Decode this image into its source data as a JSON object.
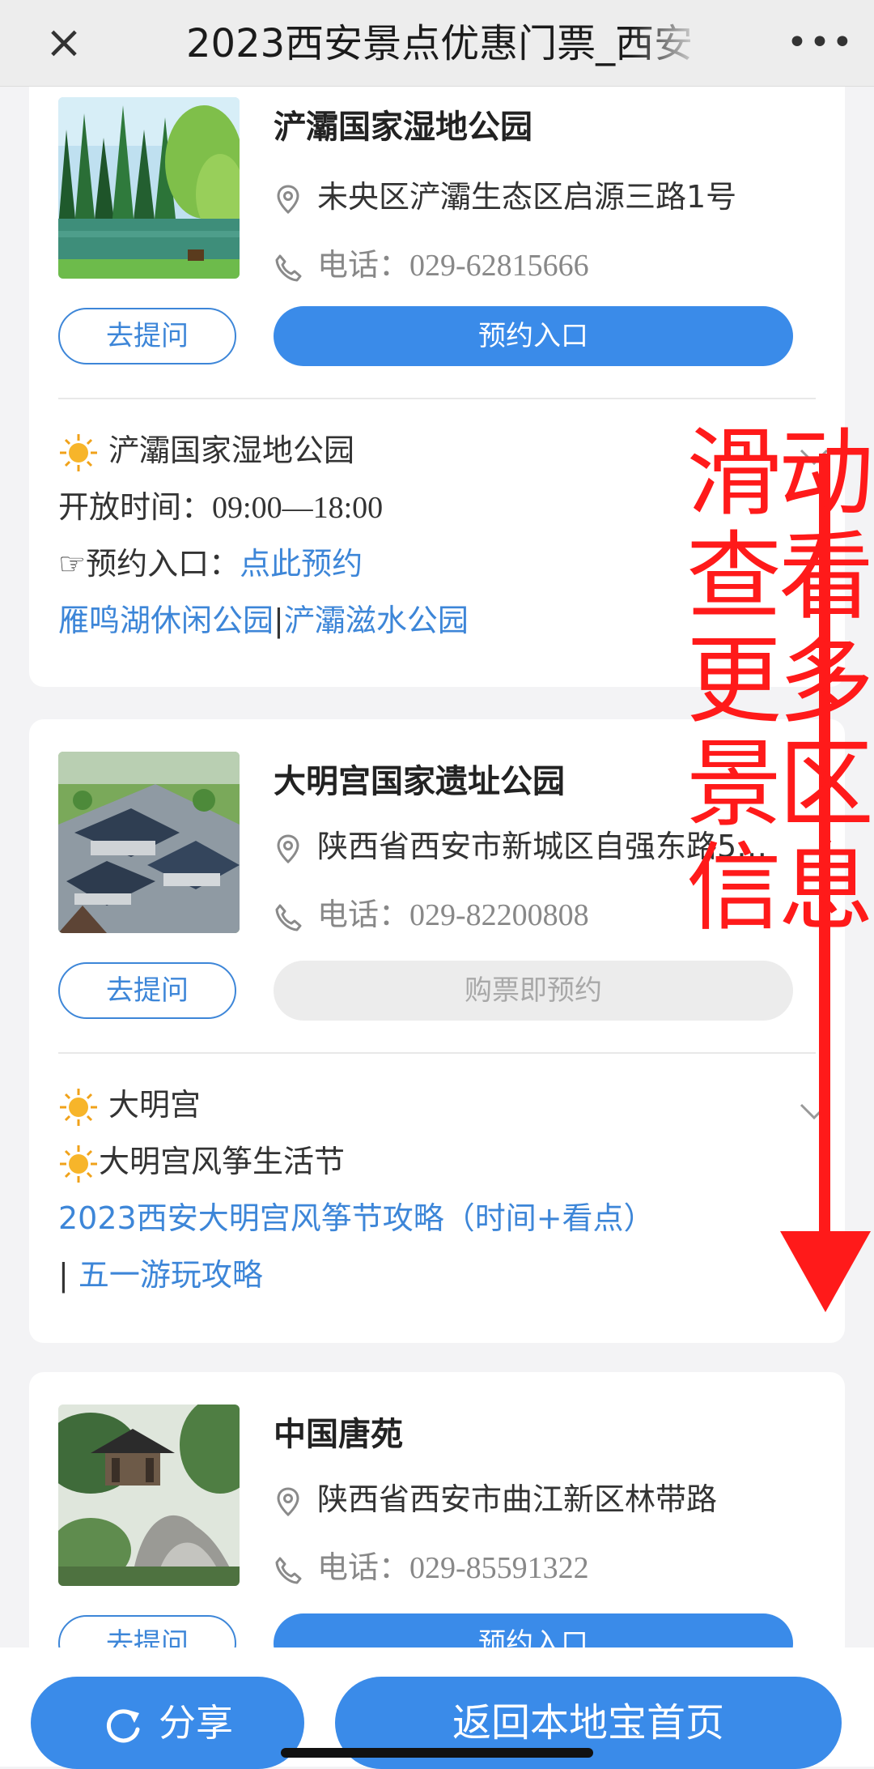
{
  "header": {
    "close_icon": "×",
    "title": "2023西安景点优惠门票_西安",
    "more_icon": "•••"
  },
  "cards": [
    {
      "name": "浐灞国家湿地公园",
      "address": "未央区浐灞生态区启源三路1号",
      "phone_label": "电话：",
      "phone": "029-62815666",
      "ask_label": "去提问",
      "book_label": "预约入口",
      "book_state": "active",
      "detail": {
        "title": "浐灞国家湿地公园",
        "hours_label": "开放时间：",
        "hours": "09:00—18:00",
        "booking_prefix": "☞预约入口：",
        "booking_link": "点此预约",
        "links": [
          "雁鸣湖休闲公园",
          "|",
          "浐灞滋水公园"
        ]
      }
    },
    {
      "name": "大明宫国家遗址公园",
      "address": "陕西省西安市新城区自强东路5…",
      "phone_label": "电话：",
      "phone": "029-82200808",
      "ask_label": "去提问",
      "book_label": "购票即预约",
      "book_state": "disabled",
      "detail": {
        "title": "大明宫",
        "event": "大明宫风筝生活节",
        "guide_link": "2023西安大明宫风筝节攻略（时间+看点）",
        "sep": "| ",
        "guide_link2": "五一游玩攻略"
      }
    },
    {
      "name": "中国唐苑",
      "address": "陕西省西安市曲江新区林带路",
      "phone_label": "电话：",
      "phone": "029-85591322",
      "ask_label": "去提问",
      "book_label": "预约入口",
      "book_state": "active"
    }
  ],
  "overlay": {
    "lines": [
      "滑动",
      "查看",
      "更多",
      "景区",
      "信息"
    ],
    "color": "#ff1a1a"
  },
  "footer": {
    "share_label": "分享",
    "home_label": "返回本地宝首页"
  },
  "colors": {
    "accent": "#3a8be9",
    "link": "#3d86d8",
    "overlay_red": "#ff1a1a"
  },
  "icons": [
    "close-icon",
    "more-icon",
    "location-pin-icon",
    "phone-icon",
    "sun-icon",
    "chevron-down-icon",
    "share-refresh-icon"
  ]
}
